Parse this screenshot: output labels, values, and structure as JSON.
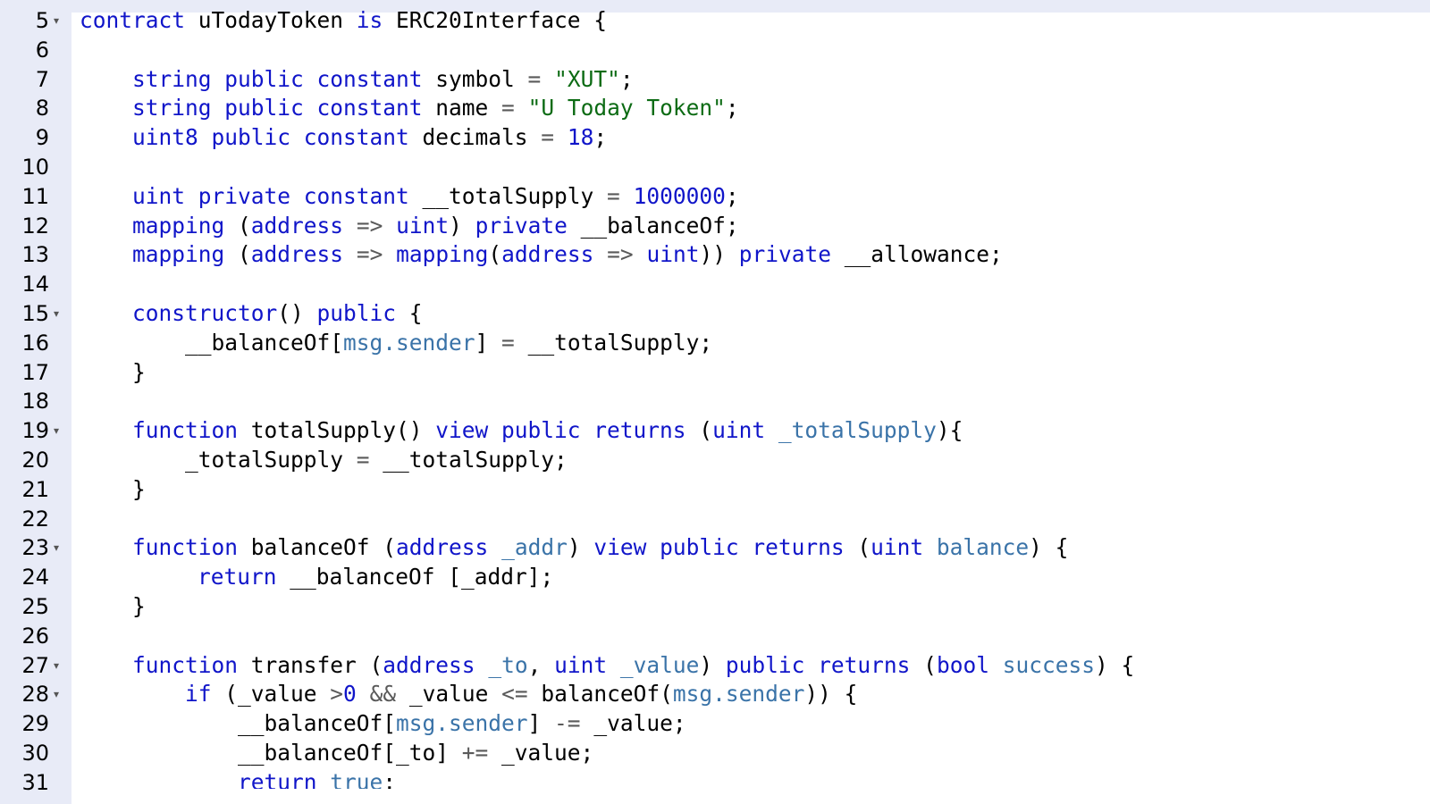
{
  "editor": {
    "colors": {
      "gutter_bg": "#e8ebf7",
      "keyword": "#1015c9",
      "string": "#0c6b14",
      "number": "#1015c9",
      "variable": "#3a73a8",
      "operator": "#5a5a5a",
      "plain": "#000000"
    },
    "fold_icon": "triangle-down-icon",
    "lines": [
      {
        "n": "5",
        "fold": true,
        "indent": 0,
        "tokens": [
          {
            "t": "contract",
            "c": "kw"
          },
          {
            "t": " uTodayToken ",
            "c": "pl"
          },
          {
            "t": "is",
            "c": "kw"
          },
          {
            "t": " ERC20Interface {",
            "c": "pl"
          }
        ]
      },
      {
        "n": "6",
        "fold": false,
        "indent": 0,
        "tokens": []
      },
      {
        "n": "7",
        "fold": false,
        "indent": 1,
        "tokens": [
          {
            "t": "string public constant",
            "c": "kw"
          },
          {
            "t": " symbol ",
            "c": "pl"
          },
          {
            "t": "=",
            "c": "op"
          },
          {
            "t": " ",
            "c": "pl"
          },
          {
            "t": "\"XUT\"",
            "c": "str"
          },
          {
            "t": ";",
            "c": "pl"
          }
        ]
      },
      {
        "n": "8",
        "fold": false,
        "indent": 1,
        "tokens": [
          {
            "t": "string public constant",
            "c": "kw"
          },
          {
            "t": " name ",
            "c": "pl"
          },
          {
            "t": "=",
            "c": "op"
          },
          {
            "t": " ",
            "c": "pl"
          },
          {
            "t": "\"U Today Token\"",
            "c": "str"
          },
          {
            "t": ";",
            "c": "pl"
          }
        ]
      },
      {
        "n": "9",
        "fold": false,
        "indent": 1,
        "tokens": [
          {
            "t": "uint8 public constant",
            "c": "kw"
          },
          {
            "t": " decimals ",
            "c": "pl"
          },
          {
            "t": "=",
            "c": "op"
          },
          {
            "t": " ",
            "c": "pl"
          },
          {
            "t": "18",
            "c": "num"
          },
          {
            "t": ";",
            "c": "pl"
          }
        ]
      },
      {
        "n": "10",
        "fold": false,
        "indent": 0,
        "tokens": []
      },
      {
        "n": "11",
        "fold": false,
        "indent": 1,
        "tokens": [
          {
            "t": "uint private constant",
            "c": "kw"
          },
          {
            "t": " __totalSupply ",
            "c": "pl"
          },
          {
            "t": "=",
            "c": "op"
          },
          {
            "t": " ",
            "c": "pl"
          },
          {
            "t": "1000000",
            "c": "num"
          },
          {
            "t": ";",
            "c": "pl"
          }
        ]
      },
      {
        "n": "12",
        "fold": false,
        "indent": 1,
        "tokens": [
          {
            "t": "mapping",
            "c": "kw"
          },
          {
            "t": " (",
            "c": "pl"
          },
          {
            "t": "address",
            "c": "kw"
          },
          {
            "t": " ",
            "c": "pl"
          },
          {
            "t": "=>",
            "c": "op"
          },
          {
            "t": " ",
            "c": "pl"
          },
          {
            "t": "uint",
            "c": "kw"
          },
          {
            "t": ") ",
            "c": "pl"
          },
          {
            "t": "private",
            "c": "kw"
          },
          {
            "t": " __balanceOf;",
            "c": "pl"
          }
        ]
      },
      {
        "n": "13",
        "fold": false,
        "indent": 1,
        "tokens": [
          {
            "t": "mapping",
            "c": "kw"
          },
          {
            "t": " (",
            "c": "pl"
          },
          {
            "t": "address",
            "c": "kw"
          },
          {
            "t": " ",
            "c": "pl"
          },
          {
            "t": "=>",
            "c": "op"
          },
          {
            "t": " ",
            "c": "pl"
          },
          {
            "t": "mapping",
            "c": "kw"
          },
          {
            "t": "(",
            "c": "pl"
          },
          {
            "t": "address",
            "c": "kw"
          },
          {
            "t": " ",
            "c": "pl"
          },
          {
            "t": "=>",
            "c": "op"
          },
          {
            "t": " ",
            "c": "pl"
          },
          {
            "t": "uint",
            "c": "kw"
          },
          {
            "t": ")) ",
            "c": "pl"
          },
          {
            "t": "private",
            "c": "kw"
          },
          {
            "t": " __allowance;",
            "c": "pl"
          }
        ]
      },
      {
        "n": "14",
        "fold": false,
        "indent": 0,
        "tokens": []
      },
      {
        "n": "15",
        "fold": true,
        "indent": 1,
        "tokens": [
          {
            "t": "constructor",
            "c": "kw"
          },
          {
            "t": "() ",
            "c": "pl"
          },
          {
            "t": "public",
            "c": "kw"
          },
          {
            "t": " {",
            "c": "pl"
          }
        ]
      },
      {
        "n": "16",
        "fold": false,
        "indent": 2,
        "tokens": [
          {
            "t": "__balanceOf[",
            "c": "pl"
          },
          {
            "t": "msg.sender",
            "c": "var"
          },
          {
            "t": "] ",
            "c": "pl"
          },
          {
            "t": "=",
            "c": "op"
          },
          {
            "t": " __totalSupply;",
            "c": "pl"
          }
        ]
      },
      {
        "n": "17",
        "fold": false,
        "indent": 1,
        "tokens": [
          {
            "t": "}",
            "c": "pl"
          }
        ]
      },
      {
        "n": "18",
        "fold": false,
        "indent": 0,
        "tokens": []
      },
      {
        "n": "19",
        "fold": true,
        "indent": 1,
        "tokens": [
          {
            "t": "function",
            "c": "kw"
          },
          {
            "t": " totalSupply() ",
            "c": "pl"
          },
          {
            "t": "view public returns",
            "c": "kw"
          },
          {
            "t": " (",
            "c": "pl"
          },
          {
            "t": "uint",
            "c": "kw"
          },
          {
            "t": " ",
            "c": "pl"
          },
          {
            "t": "_totalSupply",
            "c": "var"
          },
          {
            "t": "){",
            "c": "pl"
          }
        ]
      },
      {
        "n": "20",
        "fold": false,
        "indent": 2,
        "tokens": [
          {
            "t": "_totalSupply ",
            "c": "pl"
          },
          {
            "t": "=",
            "c": "op"
          },
          {
            "t": " __totalSupply;",
            "c": "pl"
          }
        ]
      },
      {
        "n": "21",
        "fold": false,
        "indent": 1,
        "tokens": [
          {
            "t": "}",
            "c": "pl"
          }
        ]
      },
      {
        "n": "22",
        "fold": false,
        "indent": 0,
        "tokens": []
      },
      {
        "n": "23",
        "fold": true,
        "indent": 1,
        "tokens": [
          {
            "t": "function",
            "c": "kw"
          },
          {
            "t": " balanceOf (",
            "c": "pl"
          },
          {
            "t": "address",
            "c": "kw"
          },
          {
            "t": " ",
            "c": "pl"
          },
          {
            "t": "_addr",
            "c": "var"
          },
          {
            "t": ") ",
            "c": "pl"
          },
          {
            "t": "view public returns",
            "c": "kw"
          },
          {
            "t": " (",
            "c": "pl"
          },
          {
            "t": "uint",
            "c": "kw"
          },
          {
            "t": " ",
            "c": "pl"
          },
          {
            "t": "balance",
            "c": "var"
          },
          {
            "t": ") {",
            "c": "pl"
          }
        ]
      },
      {
        "n": "24",
        "fold": false,
        "indent": 2,
        "extra": 14,
        "tokens": [
          {
            "t": "return",
            "c": "kw"
          },
          {
            "t": " __balanceOf [_addr];",
            "c": "pl"
          }
        ]
      },
      {
        "n": "25",
        "fold": false,
        "indent": 1,
        "tokens": [
          {
            "t": "}",
            "c": "pl"
          }
        ]
      },
      {
        "n": "26",
        "fold": false,
        "indent": 0,
        "tokens": []
      },
      {
        "n": "27",
        "fold": true,
        "indent": 1,
        "tokens": [
          {
            "t": "function",
            "c": "kw"
          },
          {
            "t": " transfer (",
            "c": "pl"
          },
          {
            "t": "address",
            "c": "kw"
          },
          {
            "t": " ",
            "c": "pl"
          },
          {
            "t": "_to",
            "c": "var"
          },
          {
            "t": ", ",
            "c": "pl"
          },
          {
            "t": "uint",
            "c": "kw"
          },
          {
            "t": " ",
            "c": "pl"
          },
          {
            "t": "_value",
            "c": "var"
          },
          {
            "t": ") ",
            "c": "pl"
          },
          {
            "t": "public returns",
            "c": "kw"
          },
          {
            "t": " (",
            "c": "pl"
          },
          {
            "t": "bool",
            "c": "kw"
          },
          {
            "t": " ",
            "c": "pl"
          },
          {
            "t": "success",
            "c": "var"
          },
          {
            "t": ") {",
            "c": "pl"
          }
        ]
      },
      {
        "n": "28",
        "fold": true,
        "indent": 2,
        "tokens": [
          {
            "t": "if",
            "c": "kw"
          },
          {
            "t": " (_value ",
            "c": "pl"
          },
          {
            "t": ">",
            "c": "op"
          },
          {
            "t": "0",
            "c": "num"
          },
          {
            "t": " ",
            "c": "pl"
          },
          {
            "t": "&&",
            "c": "op"
          },
          {
            "t": " _value ",
            "c": "pl"
          },
          {
            "t": "<=",
            "c": "op"
          },
          {
            "t": " balanceOf(",
            "c": "pl"
          },
          {
            "t": "msg.sender",
            "c": "var"
          },
          {
            "t": ")) {",
            "c": "pl"
          }
        ]
      },
      {
        "n": "29",
        "fold": false,
        "indent": 3,
        "tokens": [
          {
            "t": "__balanceOf[",
            "c": "pl"
          },
          {
            "t": "msg.sender",
            "c": "var"
          },
          {
            "t": "] ",
            "c": "pl"
          },
          {
            "t": "-=",
            "c": "op"
          },
          {
            "t": " _value;",
            "c": "pl"
          }
        ]
      },
      {
        "n": "30",
        "fold": false,
        "indent": 3,
        "tokens": [
          {
            "t": "__balanceOf[_to] ",
            "c": "pl"
          },
          {
            "t": "+=",
            "c": "op"
          },
          {
            "t": " _value;",
            "c": "pl"
          }
        ]
      },
      {
        "n": "31",
        "fold": false,
        "indent": 3,
        "tokens": [
          {
            "t": "return",
            "c": "kw"
          },
          {
            "t": " ",
            "c": "pl"
          },
          {
            "t": "true",
            "c": "var"
          },
          {
            "t": ";",
            "c": "pl"
          }
        ]
      }
    ]
  }
}
